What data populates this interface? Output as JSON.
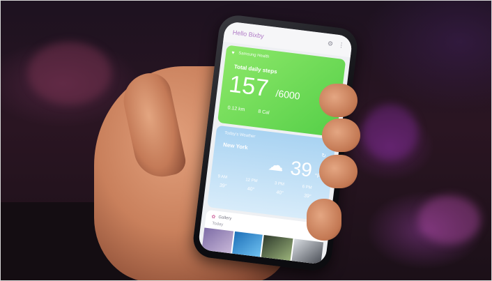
{
  "app": {
    "title": "Hello Bixby"
  },
  "health_card": {
    "source": "Samsung Health",
    "heading": "Total daily steps",
    "steps": "157",
    "goal": "/6000",
    "distance": "0.12 km",
    "calories": "8 Cal"
  },
  "weather_card": {
    "source": "Today's Weather",
    "city": "New York",
    "temperature": "39",
    "unit": "°F",
    "forecast": [
      {
        "time": "9 AM",
        "temp": "39°"
      },
      {
        "time": "12 PM",
        "temp": "40°"
      },
      {
        "time": "3 PM",
        "temp": "40°"
      },
      {
        "time": "6 PM",
        "temp": "39°"
      }
    ]
  },
  "gallery_card": {
    "source": "Gallery",
    "subtitle": "Today"
  },
  "icons": [
    "settings-icon",
    "more-icon",
    "walk-icon",
    "cloud-icon",
    "refresh-icon",
    "gallery-icon"
  ],
  "colors": {
    "health_green": "#6edb58",
    "weather_blue": "#a9d3f2",
    "bixby_accent": "#b07cc6"
  }
}
